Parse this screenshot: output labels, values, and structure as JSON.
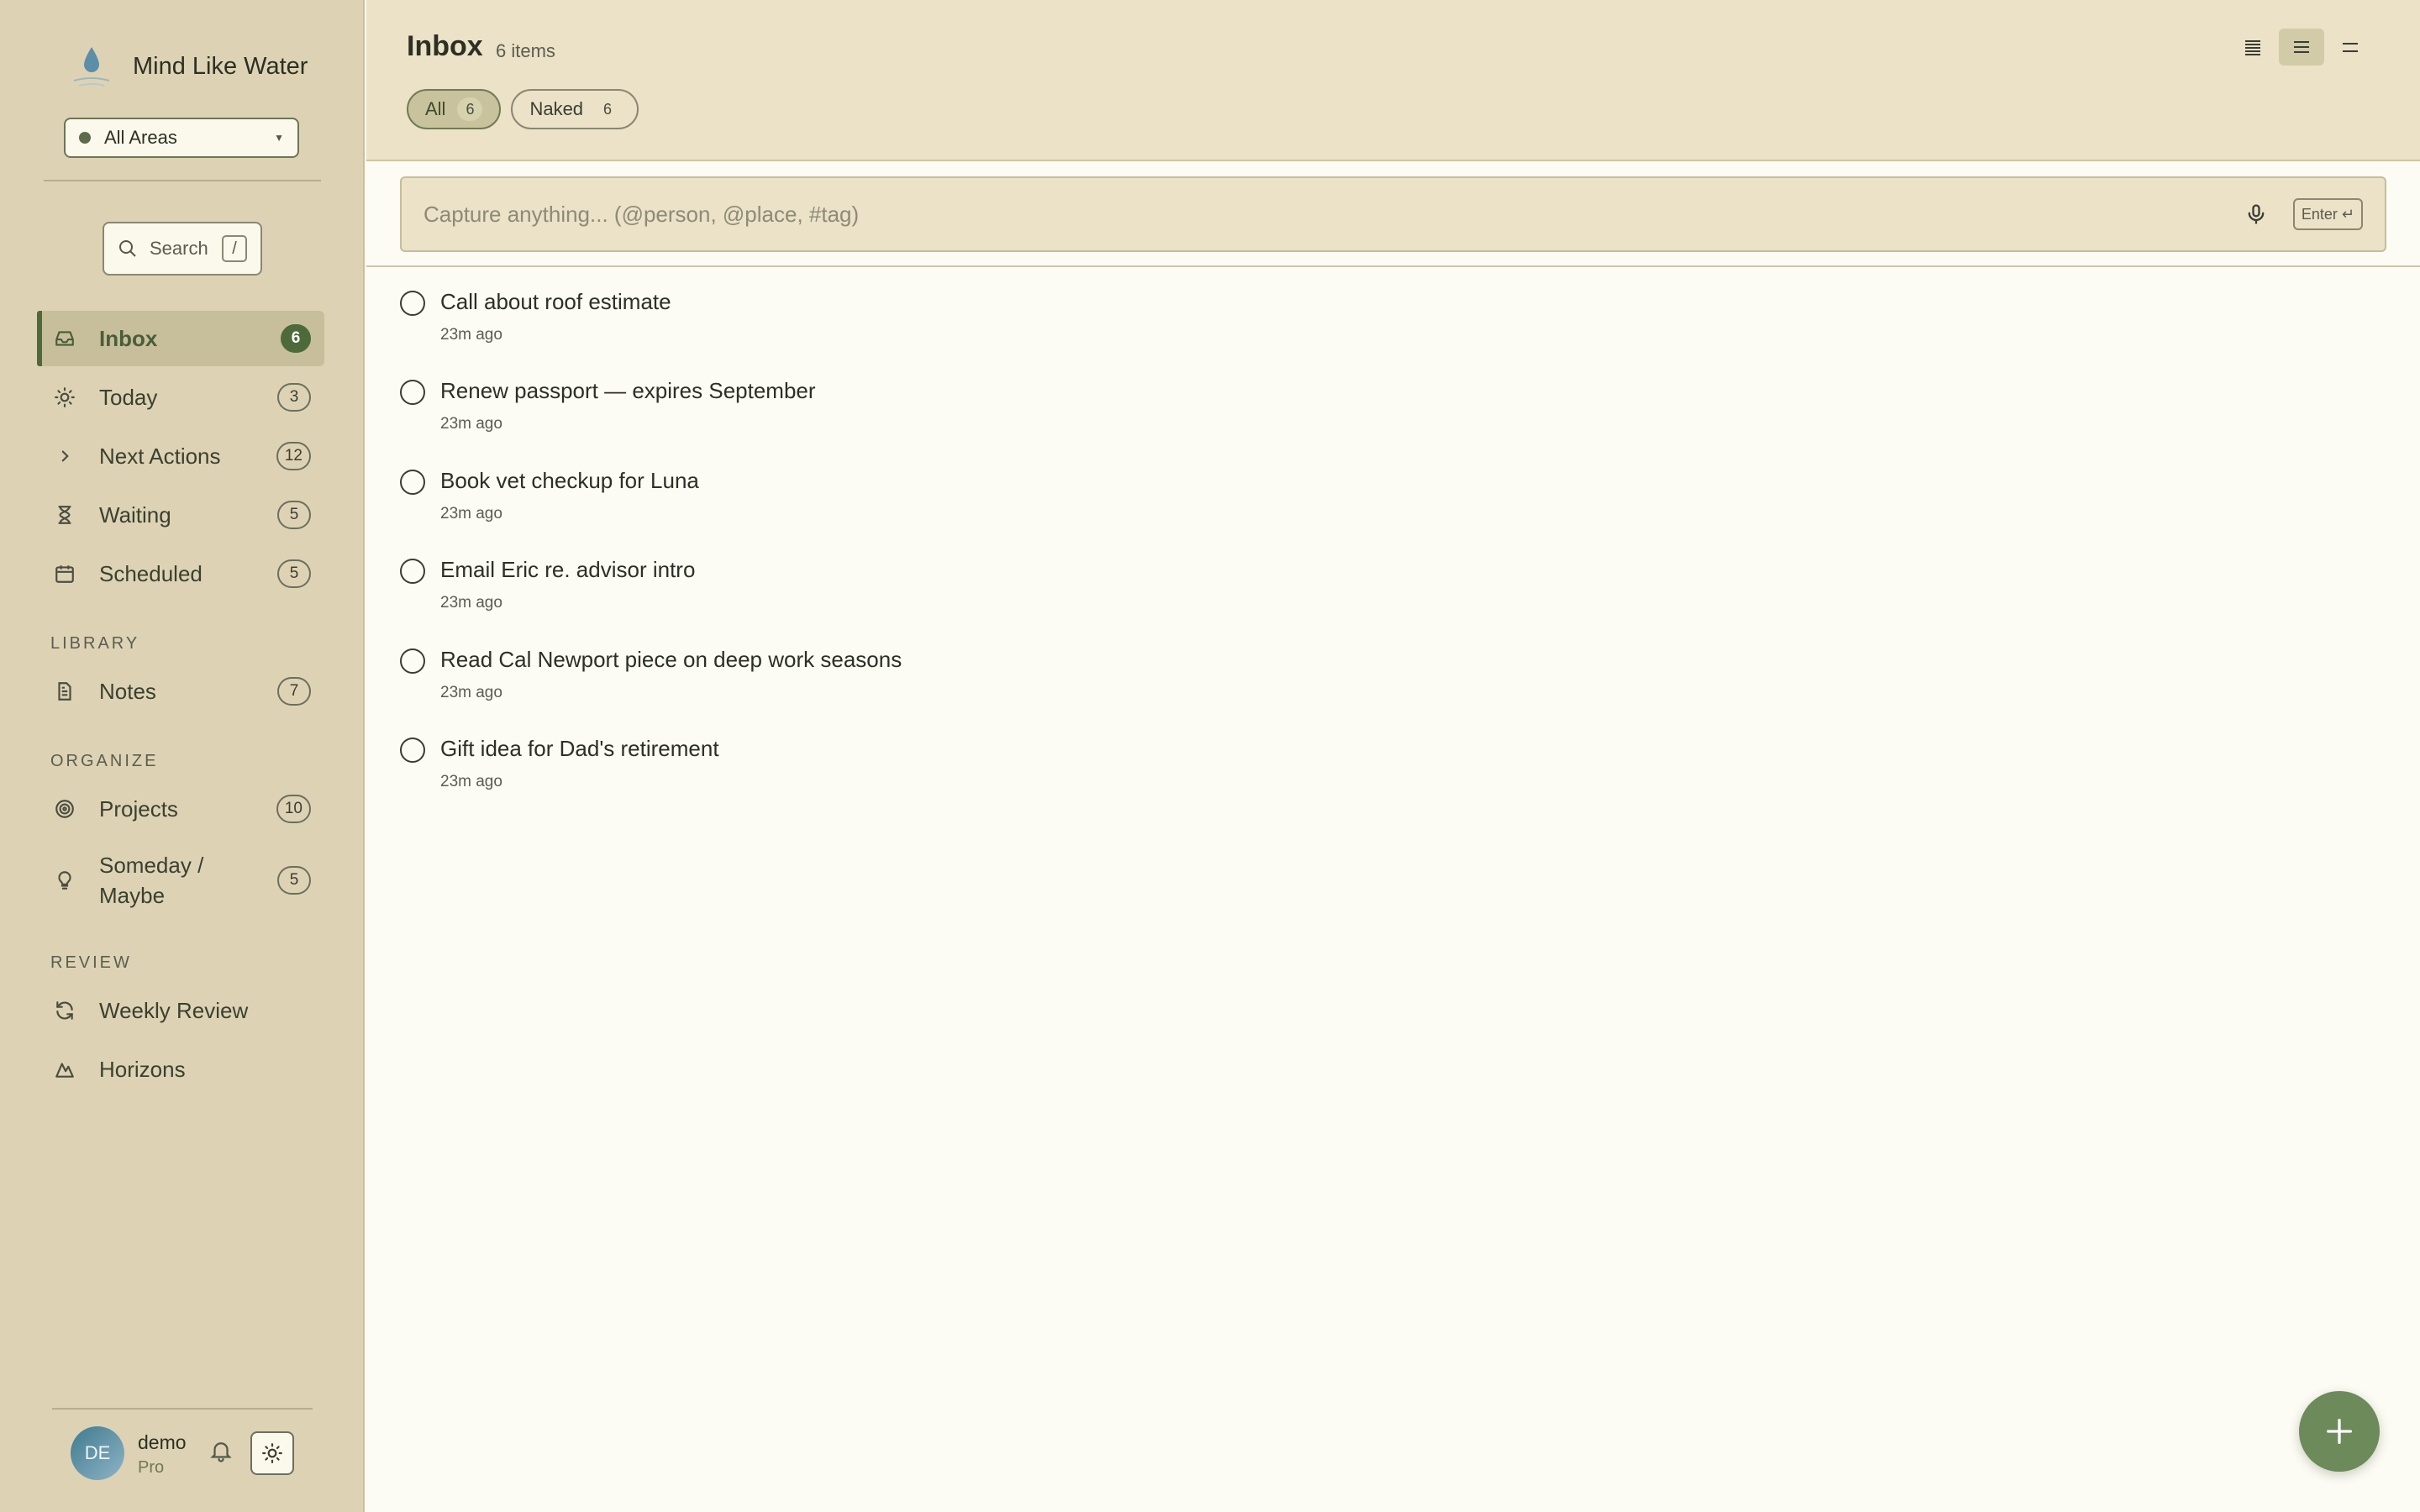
{
  "app": {
    "name": "Mind Like Water",
    "logo_icon": "water-drop-icon"
  },
  "area_selector": {
    "value": "All Areas"
  },
  "search": {
    "label": "Search",
    "shortcut": "/"
  },
  "nav": {
    "primary": [
      {
        "label": "Inbox",
        "count": "6",
        "icon": "inbox-icon",
        "active": true
      },
      {
        "label": "Today",
        "count": "3",
        "icon": "sun-icon"
      },
      {
        "label": "Next Actions",
        "count": "12",
        "icon": "chevron-right-icon"
      },
      {
        "label": "Waiting",
        "count": "5",
        "icon": "hourglass-icon"
      },
      {
        "label": "Scheduled",
        "count": "5",
        "icon": "calendar-icon"
      }
    ],
    "library_label": "LIBRARY",
    "library": [
      {
        "label": "Notes",
        "count": "7",
        "icon": "document-icon"
      }
    ],
    "organize_label": "ORGANIZE",
    "organize": [
      {
        "label": "Projects",
        "count": "10",
        "icon": "target-icon"
      },
      {
        "label": "Someday / Maybe",
        "count": "5",
        "icon": "lightbulb-icon"
      }
    ],
    "review_label": "REVIEW",
    "review": [
      {
        "label": "Weekly Review",
        "icon": "refresh-icon"
      },
      {
        "label": "Horizons",
        "icon": "mountain-icon"
      }
    ]
  },
  "user": {
    "initials": "DE",
    "name": "demo",
    "plan": "Pro"
  },
  "header": {
    "title": "Inbox",
    "count_text": "6 items",
    "filters": [
      {
        "label": "All",
        "count": "6",
        "active": true
      },
      {
        "label": "Naked",
        "count": "6"
      }
    ],
    "view_modes": [
      "compact",
      "comfortable",
      "spacious"
    ],
    "active_view": "comfortable"
  },
  "capture": {
    "placeholder": "Capture anything... (@person, @place, #tag)",
    "submit_key": "Enter ↵"
  },
  "tasks": [
    {
      "title": "Call about roof estimate",
      "meta": "23m ago"
    },
    {
      "title": "Renew passport — expires September",
      "meta": "23m ago"
    },
    {
      "title": "Book vet checkup for Luna",
      "meta": "23m ago"
    },
    {
      "title": "Email Eric re. advisor intro",
      "meta": "23m ago"
    },
    {
      "title": "Read Cal Newport piece on deep work seasons",
      "meta": "23m ago"
    },
    {
      "title": "Gift idea for Dad's retirement",
      "meta": "23m ago"
    }
  ],
  "colors": {
    "accent": "#4d6a3a",
    "sidebar_bg": "#ddd3b4",
    "header_bg": "#ebe2c7",
    "fab": "#6d8a5a"
  }
}
